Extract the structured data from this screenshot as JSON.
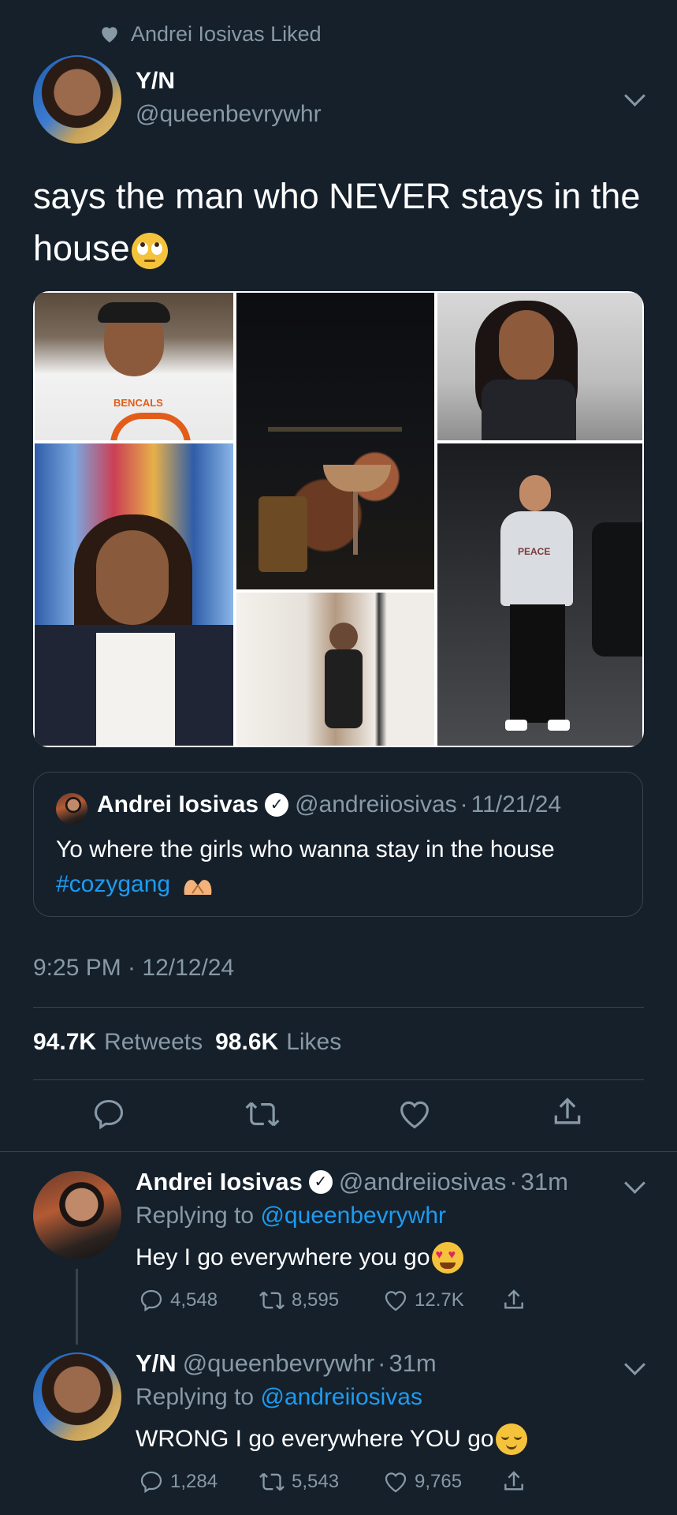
{
  "context": {
    "text": "Andrei Iosivas Liked"
  },
  "tweet": {
    "display_name": "Y/N",
    "handle": "@queenbevrywhr",
    "text": "says the man who NEVER stays in the house",
    "timestamp": "9:25 PM · 12/12/24",
    "retweets_count": "94.7K",
    "retweets_label": "Retweets",
    "likes_count": "98.6K",
    "likes_label": "Likes",
    "photos": [
      {
        "name": "football-player-photo",
        "caption": "BENCALS"
      },
      {
        "name": "cocktail-night-photo"
      },
      {
        "name": "parking-garage-selfie-photo"
      },
      {
        "name": "store-aisle-selfie-photo"
      },
      {
        "name": "mirror-selfie-photo"
      },
      {
        "name": "man-in-sweater-photo",
        "caption": "PEACE"
      }
    ]
  },
  "quoted": {
    "display_name": "Andrei Iosivas",
    "handle": "@andreiiosivas",
    "date": "11/21/24",
    "text": "Yo where the girls who wanna stay in the house",
    "hashtag": "#cozygang"
  },
  "replies": [
    {
      "display_name": "Andrei Iosivas",
      "handle": "@andreiiosivas",
      "time": "31m",
      "replying_prefix": "Replying to",
      "replying_to": "@queenbevrywhr",
      "text": "Hey I go everywhere you go",
      "replies": "4,548",
      "retweets": "8,595",
      "likes": "12.7K"
    },
    {
      "display_name": "Y/N",
      "handle": "@queenbevrywhr",
      "time": "31m",
      "replying_prefix": "Replying to",
      "replying_to": "@andreiiosivas",
      "text": "WRONG I go everywhere YOU go",
      "replies": "1,284",
      "retweets": "5,543",
      "likes": "9,765"
    }
  ],
  "colors": {
    "background": "#15202b",
    "muted": "#8899a6",
    "accent": "#1d9bf0",
    "divider": "#38444d"
  }
}
